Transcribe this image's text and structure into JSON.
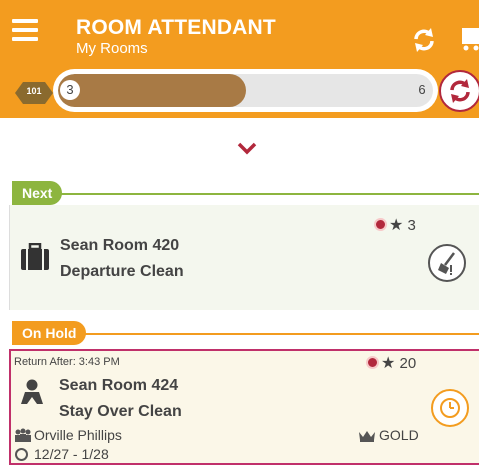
{
  "header": {
    "title": "ROOM ATTENDANT",
    "subtitle": "My Rooms"
  },
  "progress": {
    "room_badge": "101",
    "start_count": "3",
    "end_count": "6",
    "fraction": 0.5
  },
  "sections": {
    "next_label": "Next",
    "onhold_label": "On Hold"
  },
  "next_card": {
    "room": "Sean Room 420",
    "clean_type": "Departure Clean",
    "credits": "3",
    "icon": "luggage-icon",
    "action_icon": "clean-broom-icon"
  },
  "onhold_card": {
    "return_after": "Return After: 3:43 PM",
    "room": "Sean Room 424",
    "clean_type": "Stay Over Clean",
    "credits": "20",
    "guest": "Orville Phillips",
    "vip": "GOLD",
    "dates": "12/27 - 1/28",
    "icon": "person-icon",
    "action_icon": "clock-icon"
  },
  "colors": {
    "header_bg": "#f39c1f",
    "progress_fill": "#a87a45",
    "next_green": "#8db53f",
    "onhold_orange": "#f39c1f",
    "alert_red": "#b2283c",
    "onhold_border": "#c0306a"
  }
}
